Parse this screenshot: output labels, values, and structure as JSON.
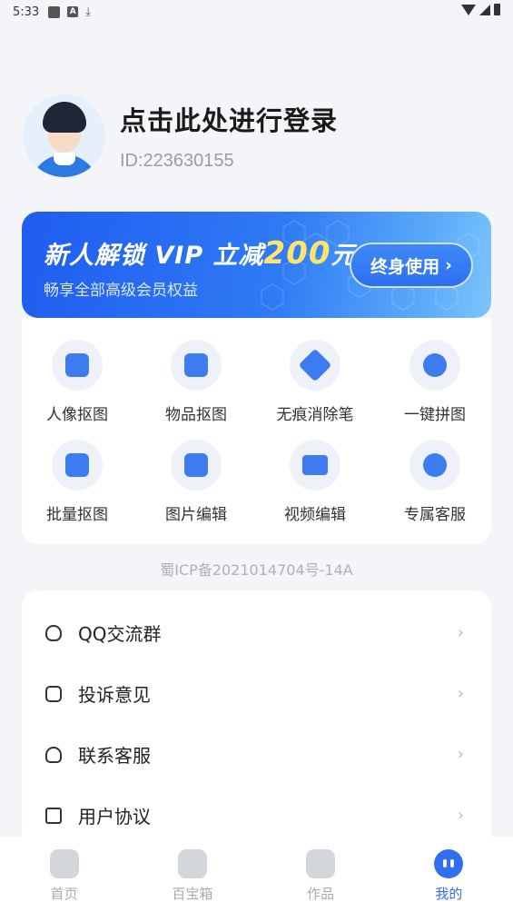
{
  "status_bar": {
    "time": "5:33",
    "icon_a": "A",
    "download": "⤓"
  },
  "profile": {
    "login_text": "点击此处进行登录",
    "user_id": "ID:223630155"
  },
  "vip": {
    "title_prefix": "新人解锁",
    "title_vip": "VIP",
    "title_mid": "立减",
    "title_amount": "200",
    "title_suffix": "元",
    "subtitle": "畅享全部高级会员权益",
    "button_label": "终身使用",
    "button_arrow": "›"
  },
  "tools": [
    {
      "label": "人像抠图",
      "icon": "portrait-icon"
    },
    {
      "label": "物品抠图",
      "icon": "bag-icon"
    },
    {
      "label": "无痕消除笔",
      "icon": "eraser-icon"
    },
    {
      "label": "一键拼图",
      "icon": "puzzle-icon"
    },
    {
      "label": "批量抠图",
      "icon": "batch-icon"
    },
    {
      "label": "图片编辑",
      "icon": "edit-icon"
    },
    {
      "label": "视频编辑",
      "icon": "video-icon"
    },
    {
      "label": "专属客服",
      "icon": "service-icon"
    }
  ],
  "icp": "蜀ICP备2021014704号-14A",
  "menu": [
    {
      "label": "QQ交流群",
      "icon": "qq-icon",
      "arrow": "›"
    },
    {
      "label": "投诉意见",
      "icon": "chat-icon",
      "arrow": "›"
    },
    {
      "label": "联系客服",
      "icon": "headset-icon",
      "arrow": "›"
    },
    {
      "label": "用户协议",
      "icon": "document-icon",
      "arrow": "›"
    }
  ],
  "tabs": [
    {
      "label": "首页",
      "icon": "home-icon",
      "active": false
    },
    {
      "label": "百宝箱",
      "icon": "toolbox-icon",
      "active": false
    },
    {
      "label": "作品",
      "icon": "works-icon",
      "active": false
    },
    {
      "label": "我的",
      "icon": "profile-icon",
      "active": true
    }
  ],
  "colors": {
    "accent": "#2f6ff0",
    "background": "#f3f5f8",
    "vip_amount": "#ffe46b"
  }
}
